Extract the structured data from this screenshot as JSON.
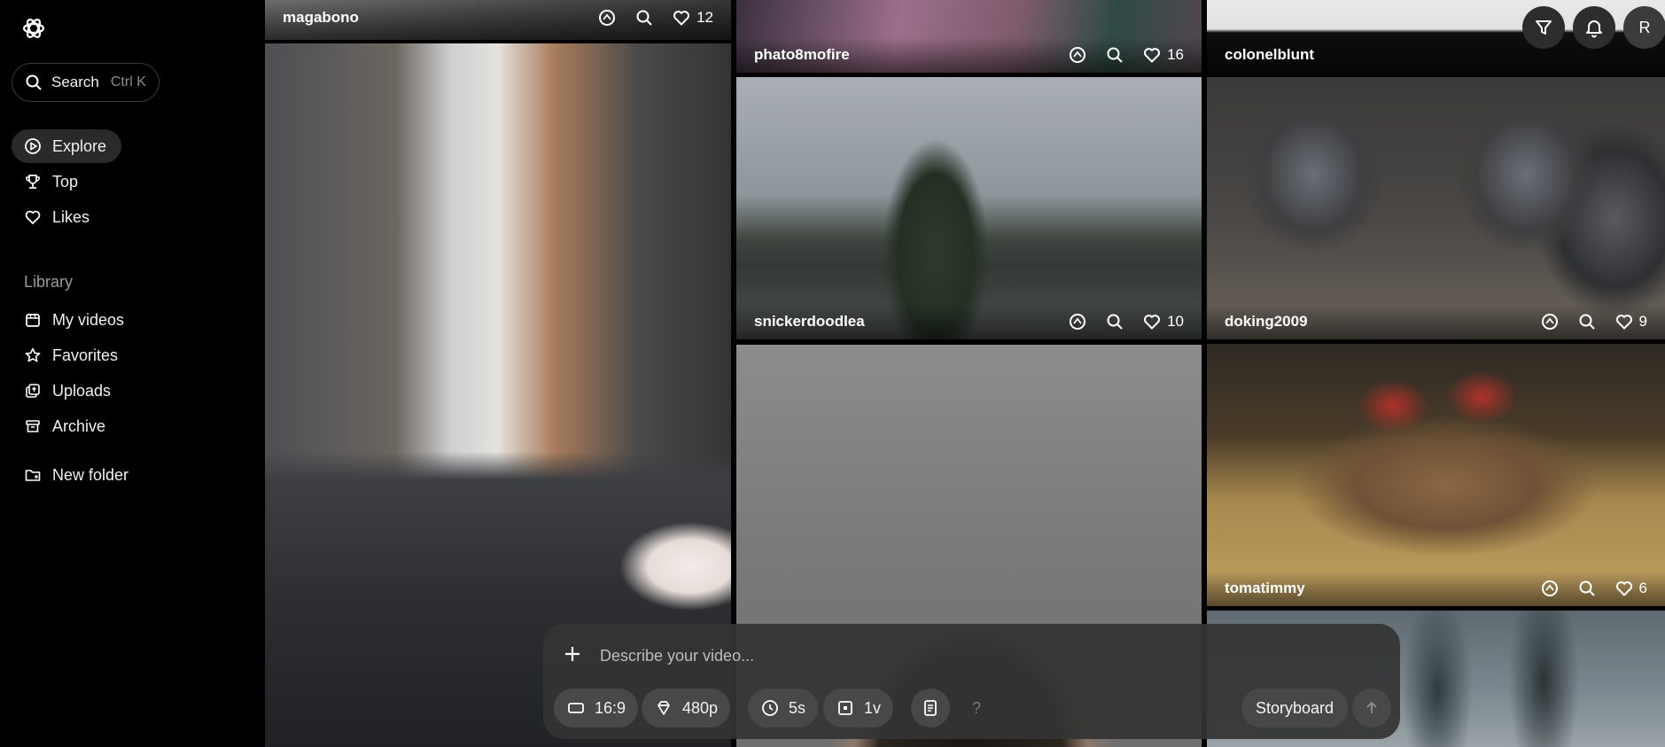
{
  "sidebar": {
    "search": {
      "label": "Search",
      "shortcut": "Ctrl K"
    },
    "nav": [
      {
        "label": "Explore",
        "icon": "explore-icon"
      },
      {
        "label": "Top",
        "icon": "trophy-icon"
      },
      {
        "label": "Likes",
        "icon": "heart-icon"
      }
    ],
    "library_title": "Library",
    "library": [
      {
        "label": "My videos",
        "icon": "video-library-icon"
      },
      {
        "label": "Favorites",
        "icon": "star-icon"
      },
      {
        "label": "Uploads",
        "icon": "upload-icon"
      },
      {
        "label": "Archive",
        "icon": "archive-icon"
      }
    ],
    "new_folder": "New folder"
  },
  "feed": {
    "tiles": [
      {
        "user": "magabono",
        "likes": "12"
      },
      {
        "user": "phato8mofire",
        "likes": "16"
      },
      {
        "user": "colonelblunt",
        "likes": ""
      },
      {
        "user": "snickerdoodlea",
        "likes": "10"
      },
      {
        "user": "doking2009",
        "likes": "9"
      },
      {
        "user": "tomatimmy",
        "likes": "6"
      }
    ]
  },
  "header": {
    "avatar_initial": "R"
  },
  "composer": {
    "placeholder": "Describe your video...",
    "aspect": "16:9",
    "resolution": "480p",
    "duration": "5s",
    "variations": "1v",
    "help": "?",
    "storyboard": "Storyboard"
  }
}
